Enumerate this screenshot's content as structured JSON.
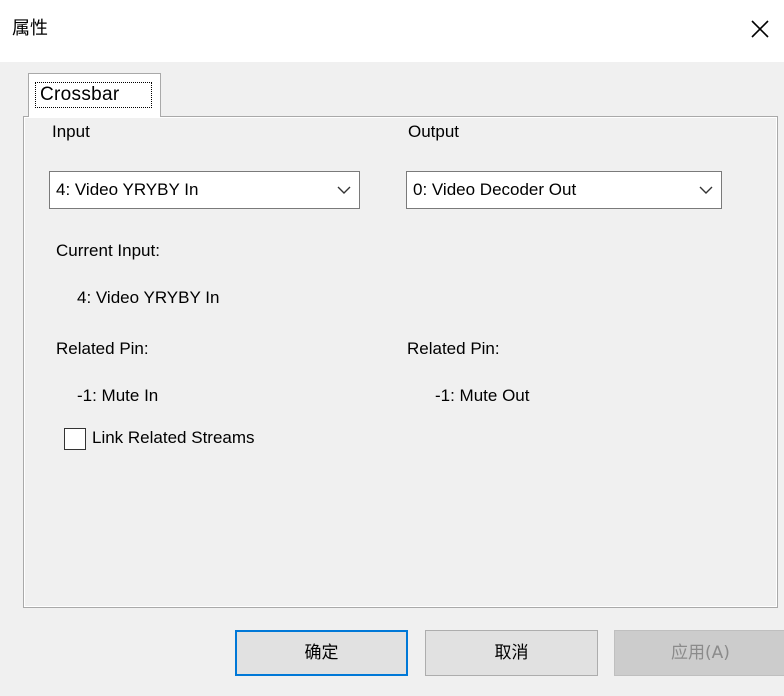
{
  "window": {
    "title": "属性",
    "close_icon": "close-icon"
  },
  "tabs": [
    {
      "label": "Crossbar",
      "selected": true
    }
  ],
  "input_group": {
    "legend": "Input",
    "selected_value": "4: Video YRYBY In",
    "current_input_label": "Current Input:",
    "current_input_value": "4: Video YRYBY In",
    "related_pin_label": "Related Pin:",
    "related_pin_value": "-1: Mute In",
    "link_checkbox_label": "Link Related Streams",
    "link_checkbox_checked": false
  },
  "output_group": {
    "legend": "Output",
    "selected_value": "0: Video Decoder Out",
    "related_pin_label": "Related Pin:",
    "related_pin_value": "-1: Mute Out"
  },
  "buttons": {
    "ok": "确定",
    "cancel": "取消",
    "apply": "应用(A)",
    "apply_enabled": false
  },
  "colors": {
    "focus_border": "#0078d7",
    "window_bg": "#f0f0f0",
    "disabled_text": "#8b8b8b"
  }
}
